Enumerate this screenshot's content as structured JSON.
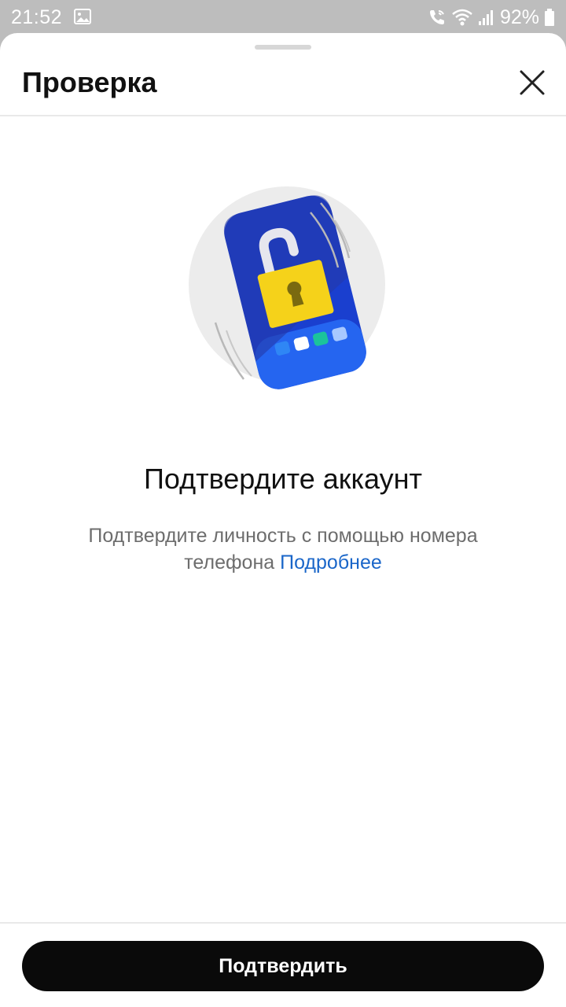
{
  "status_bar": {
    "time": "21:52",
    "battery_percent": "92%",
    "icons": [
      "gallery-icon",
      "wifi-call-icon",
      "wifi-icon",
      "signal-icon",
      "battery-icon"
    ]
  },
  "header": {
    "title": "Проверка",
    "close_icon": "close-icon"
  },
  "illustration": {
    "name": "phone-unlock-illustration"
  },
  "main": {
    "title": "Подтвердите аккаунт",
    "description_text": "Подтвердите личность с помощью номера телефона",
    "learn_more_link": "Подробнее"
  },
  "footer": {
    "confirm_label": "Подтвердить"
  },
  "colors": {
    "link": "#1a66c9",
    "button_background": "#0a0a0a",
    "phone_blue": "#1a3fcf",
    "lock_yellow": "#f5d21a"
  }
}
